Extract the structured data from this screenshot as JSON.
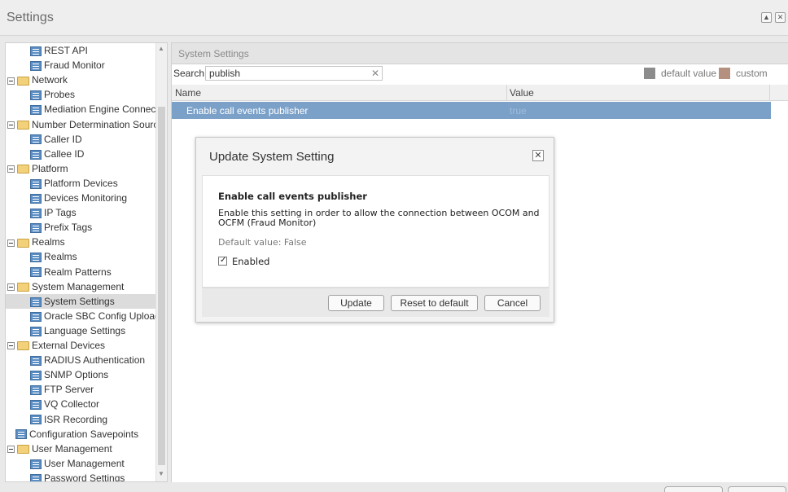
{
  "window": {
    "title": "Settings",
    "ctrl_up": "▲",
    "ctrl_close": "✕"
  },
  "tree": {
    "items": [
      {
        "label": "REST API",
        "type": "leaf",
        "level": 2
      },
      {
        "label": "Fraud Monitor",
        "type": "leaf",
        "level": 2
      },
      {
        "label": "Network",
        "type": "folder",
        "level": 1
      },
      {
        "label": "Probes",
        "type": "leaf",
        "level": 2
      },
      {
        "label": "Mediation Engine Connecti",
        "type": "leaf",
        "level": 2
      },
      {
        "label": "Number Determination Source",
        "type": "folder",
        "level": 1
      },
      {
        "label": "Caller ID",
        "type": "leaf",
        "level": 2
      },
      {
        "label": "Callee ID",
        "type": "leaf",
        "level": 2
      },
      {
        "label": "Platform",
        "type": "folder",
        "level": 1
      },
      {
        "label": "Platform Devices",
        "type": "leaf",
        "level": 2
      },
      {
        "label": "Devices Monitoring",
        "type": "leaf",
        "level": 2
      },
      {
        "label": "IP Tags",
        "type": "leaf",
        "level": 2
      },
      {
        "label": "Prefix Tags",
        "type": "leaf",
        "level": 2
      },
      {
        "label": "Realms",
        "type": "folder",
        "level": 1
      },
      {
        "label": "Realms",
        "type": "leaf",
        "level": 2
      },
      {
        "label": "Realm Patterns",
        "type": "leaf",
        "level": 2
      },
      {
        "label": "System Management",
        "type": "folder",
        "level": 1
      },
      {
        "label": "System Settings",
        "type": "leaf",
        "level": 2,
        "selected": true
      },
      {
        "label": "Oracle SBC Config Upload",
        "type": "leaf",
        "level": 2
      },
      {
        "label": "Language Settings",
        "type": "leaf",
        "level": 2
      },
      {
        "label": "External Devices",
        "type": "folder",
        "level": 1
      },
      {
        "label": "RADIUS Authentication",
        "type": "leaf",
        "level": 2
      },
      {
        "label": "SNMP Options",
        "type": "leaf",
        "level": 2
      },
      {
        "label": "FTP Server",
        "type": "leaf",
        "level": 2
      },
      {
        "label": "VQ Collector",
        "type": "leaf",
        "level": 2
      },
      {
        "label": "ISR Recording",
        "type": "leaf",
        "level": 2
      },
      {
        "label": "Configuration Savepoints",
        "type": "leaf",
        "level": 1
      },
      {
        "label": "User Management",
        "type": "folder",
        "level": 1
      },
      {
        "label": "User Management",
        "type": "leaf",
        "level": 2
      },
      {
        "label": "Password Settings",
        "type": "leaf",
        "level": 2
      }
    ]
  },
  "main": {
    "header": "System Settings",
    "search_label": "Search:",
    "search_value": "publish",
    "search_clear": "✕",
    "legend": {
      "default_label": "default value",
      "default_color": "#8c8c8c",
      "custom_label": "custom value",
      "custom_color": "#b3917e"
    },
    "columns": [
      "Name",
      "Value"
    ],
    "rows": [
      {
        "name": "Enable call events publisher",
        "value": "true"
      }
    ],
    "row_color": "#7ba1c9"
  },
  "dialog": {
    "title": "Update System Setting",
    "close": "✕",
    "setting_name": "Enable call events publisher",
    "description": "Enable this setting in order to allow the connection between OCOM and OCFM (Fraud Monitor)",
    "default_value": "Default value: False",
    "checkbox_label": "Enabled",
    "checked": true,
    "buttons": {
      "update": "Update",
      "reset": "Reset to default",
      "cancel": "Cancel"
    }
  }
}
